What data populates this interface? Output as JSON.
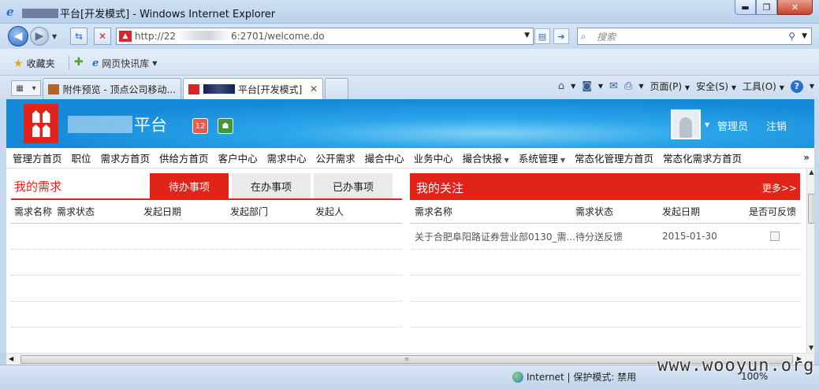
{
  "window": {
    "title": "平台[开发模式] - Windows Internet Explorer"
  },
  "address": {
    "url_prefix": "http://22",
    "url_suffix": "6:2701/welcome.do",
    "search_placeholder": "搜索"
  },
  "favorites": {
    "label": "收藏夹",
    "web_slice": "网页快讯库"
  },
  "tabs": [
    {
      "label": "附件预览 - 顶点公司移动..."
    },
    {
      "label": "平台[开发模式]"
    }
  ],
  "command_bar": {
    "page": "页面(P)",
    "safety": "安全(S)",
    "tools": "工具(O)"
  },
  "site": {
    "name": "平台",
    "badge_count": "12",
    "user": "管理员",
    "logout": "注销"
  },
  "nav": [
    {
      "label": "管理方首页"
    },
    {
      "label": "职位"
    },
    {
      "label": "需求方首页"
    },
    {
      "label": "供给方首页"
    },
    {
      "label": "客户中心"
    },
    {
      "label": "需求中心"
    },
    {
      "label": "公开需求"
    },
    {
      "label": "撮合中心"
    },
    {
      "label": "业务中心"
    },
    {
      "label": "撮合快报",
      "dropdown": true
    },
    {
      "label": "系统管理",
      "dropdown": true
    },
    {
      "label": "常态化管理方首页"
    },
    {
      "label": "常态化需求方首页"
    }
  ],
  "nav_more": "»",
  "my_demand": {
    "title": "我的需求",
    "tabs": [
      "待办事项",
      "在办事项",
      "已办事项"
    ],
    "active_tab": 0,
    "columns": [
      "需求名称",
      "需求状态",
      "发起日期",
      "发起部门",
      "发起人"
    ]
  },
  "my_follow": {
    "title": "我的关注",
    "more": "更多>>",
    "columns": [
      "需求名称",
      "需求状态",
      "发起日期",
      "是否可反馈"
    ],
    "rows": [
      {
        "name": "关于合肥阜阳路证券营业部0130_需...",
        "status": "待分送反馈",
        "date": "2015-01-30",
        "feedback": false
      }
    ]
  },
  "status": {
    "zone": "Internet | 保护模式: 禁用",
    "zoom": "100%"
  },
  "watermark": "www.wooyun.org",
  "colors": {
    "brand_red": "#e2231a",
    "banner_blue": "#1588d8"
  }
}
